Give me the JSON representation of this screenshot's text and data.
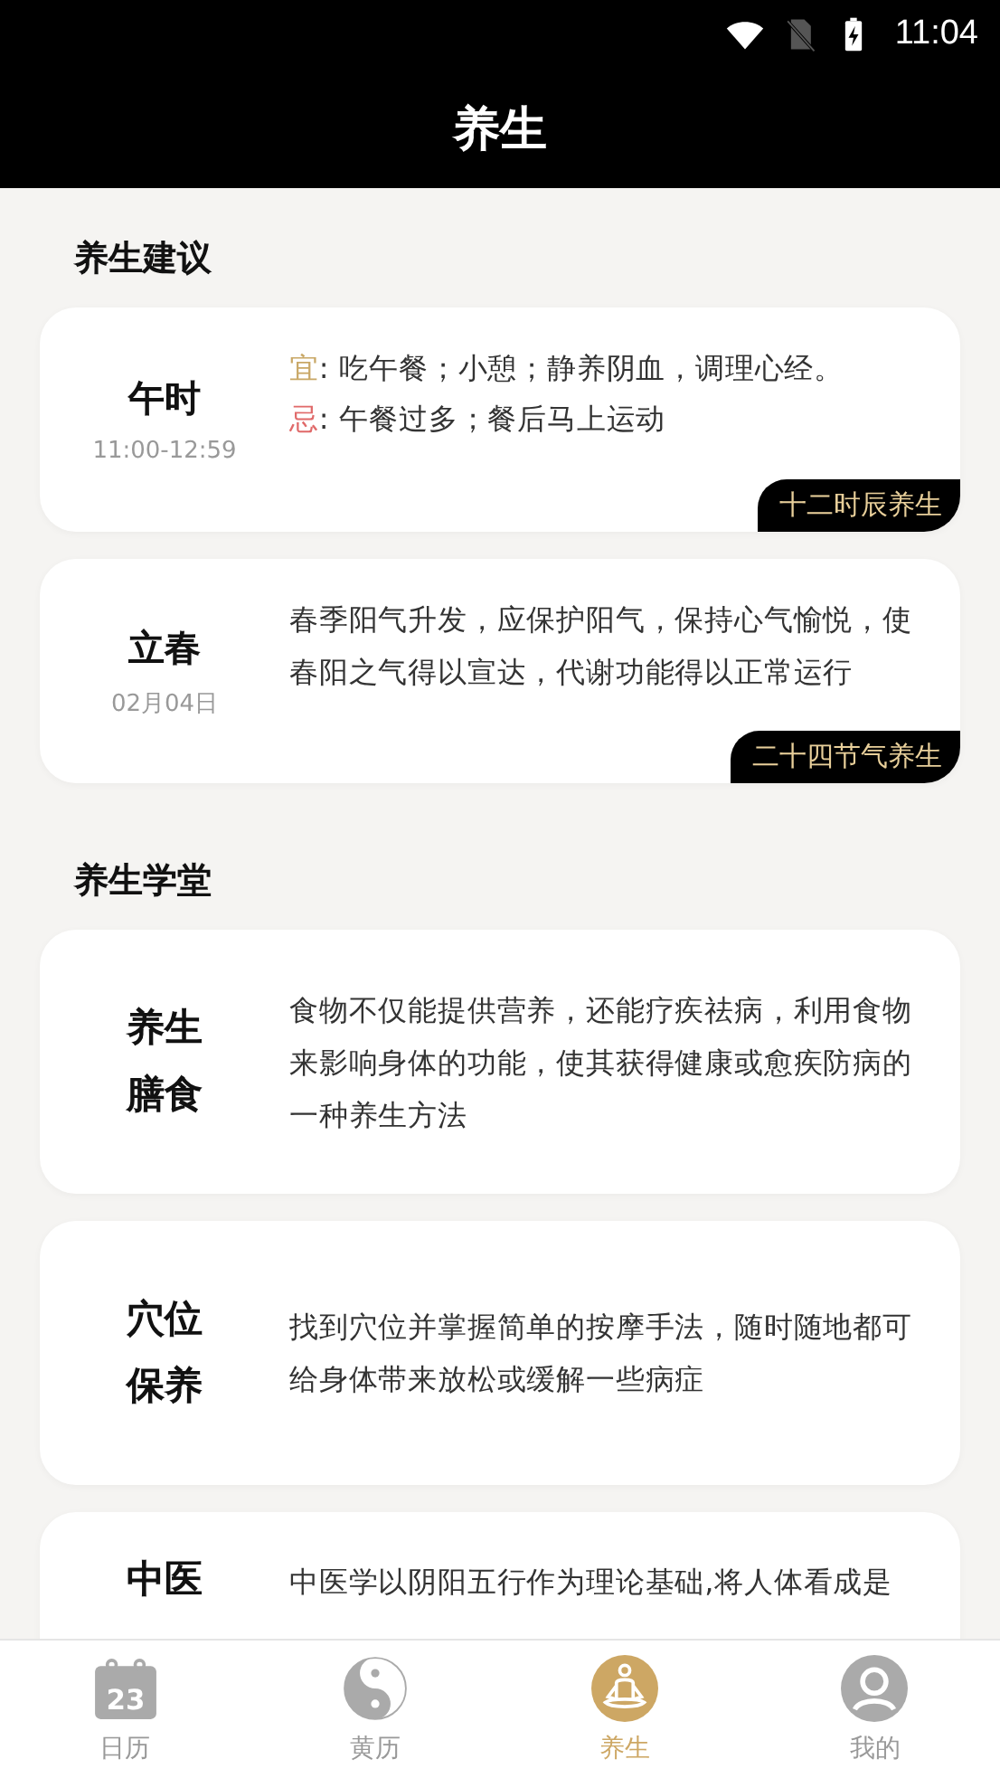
{
  "status_bar": {
    "time": "11:04"
  },
  "header": {
    "title": "养生"
  },
  "sections": [
    {
      "title": "养生建议",
      "cards": [
        {
          "kind": "advice",
          "name": "午时",
          "sub": "11:00-12:59",
          "lines": [
            {
              "label": "宜",
              "color": "#c9a867",
              "text": ": 吃午餐；小憩；静养阴血，调理心经。"
            },
            {
              "label": "忌",
              "color": "#e06a6a",
              "text": ": 午餐过多；餐后马上运动"
            }
          ],
          "tag": "十二时辰养生"
        },
        {
          "kind": "advice",
          "name": "立春",
          "sub": "02月04日",
          "text": "春季阳气升发，应保护阳气，保持心气愉悦，使春阳之气得以宣达，代谢功能得以正常运行",
          "tag": "二十四节气养生"
        }
      ]
    },
    {
      "title": "养生学堂",
      "cards": [
        {
          "kind": "lesson",
          "name": "养生膳食",
          "text": "食物不仅能提供营养，还能疗疾祛病，利用食物来影响身体的功能，使其获得健康或愈疾防病的一种养生方法"
        },
        {
          "kind": "lesson",
          "name": "穴位保养",
          "text": "找到穴位并掌握简单的按摩手法，随时随地都可给身体带来放松或缓解一些病症"
        },
        {
          "kind": "lesson",
          "name": "中医",
          "text": "中医学以阴阳五行作为理论基础,将人体看成是"
        }
      ]
    }
  ],
  "tabs": [
    {
      "kind": "calendar",
      "icon_text": "23",
      "label": "日历",
      "selected": false
    },
    {
      "kind": "yinyang",
      "label": "黄历",
      "selected": false
    },
    {
      "kind": "meditate",
      "label": "养生",
      "selected": true
    },
    {
      "kind": "profile",
      "label": "我的",
      "selected": false
    }
  ]
}
